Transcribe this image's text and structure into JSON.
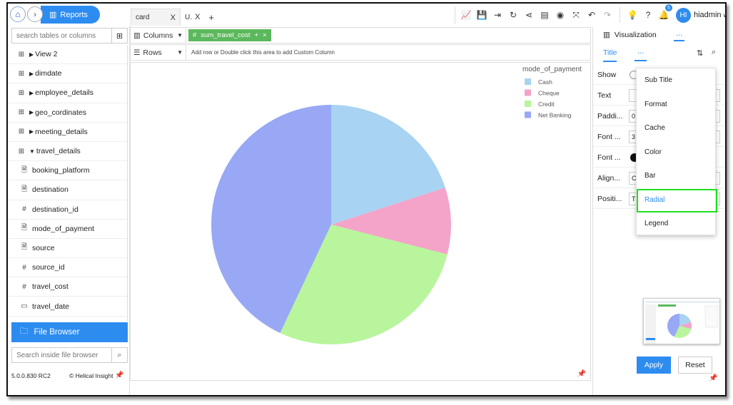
{
  "topbar": {
    "home_icon": "home-icon",
    "reports_label": "Reports",
    "tabs": [
      {
        "label": "card",
        "close": "X"
      },
      {
        "label": "U.",
        "close": "X"
      }
    ],
    "add_tab": "+",
    "notification_count": "5",
    "avatar_initials": "HI",
    "username": "hiadmin"
  },
  "left": {
    "search_placeholder": "search tables or columns",
    "tree": [
      {
        "label": "View 2",
        "icon": "table-icon",
        "level": 0
      },
      {
        "label": "dimdate",
        "icon": "table-icon",
        "level": 0
      },
      {
        "label": "employee_details",
        "icon": "table-icon",
        "level": 0
      },
      {
        "label": "geo_cordinates",
        "icon": "table-icon",
        "level": 0
      },
      {
        "label": "meeting_details",
        "icon": "table-icon",
        "level": 0
      },
      {
        "label": "travel_details",
        "icon": "table-icon",
        "level": 0
      },
      {
        "label": "booking_platform",
        "icon": "text-field-icon",
        "level": 1
      },
      {
        "label": "destination",
        "icon": "text-field-icon",
        "level": 1
      },
      {
        "label": "destination_id",
        "icon": "number-field-icon",
        "level": 1
      },
      {
        "label": "mode_of_payment",
        "icon": "text-field-icon",
        "level": 1
      },
      {
        "label": "source",
        "icon": "text-field-icon",
        "level": 1
      },
      {
        "label": "source_id",
        "icon": "number-field-icon",
        "level": 1
      },
      {
        "label": "travel_cost",
        "icon": "number-field-icon",
        "level": 1
      },
      {
        "label": "travel_date",
        "icon": "date-field-icon",
        "level": 1
      }
    ],
    "file_browser_label": "File Browser",
    "file_search_placeholder": "Search inside file browser",
    "version": "5.0.0.830 RC2",
    "brand": "Helical Insight"
  },
  "shelves": {
    "columns_label": "Columns",
    "column_pill": "sum_travel_cost",
    "rows_label": "Rows",
    "rows_hint": "Add row or Double click this area to add Custom Column"
  },
  "chart_data": {
    "type": "pie",
    "categories": [
      "Cash",
      "Cheque",
      "Credit",
      "Net Banking"
    ],
    "values": [
      20,
      9,
      28,
      43
    ],
    "colors": [
      "#a8d3f2",
      "#f3a4c8",
      "#b8f59c",
      "#98a8f4"
    ],
    "legend_title": "mode_of_payment",
    "legend_position": "top-right"
  },
  "right": {
    "visualization_label": "Visualization",
    "more_tab": "...",
    "title_tab": "Title",
    "rows": [
      {
        "label": "Show",
        "control": "toggle",
        "value": ""
      },
      {
        "label": "Text",
        "control": "input",
        "value": ""
      },
      {
        "label": "Paddi...",
        "control": "input",
        "value": "0"
      },
      {
        "label": "Font ...",
        "control": "input",
        "value": "3"
      },
      {
        "label": "Font ...",
        "control": "swatch",
        "value": ""
      },
      {
        "label": "Align...",
        "control": "input",
        "value": "C"
      },
      {
        "label": "Positi...",
        "control": "input",
        "value": "T"
      }
    ],
    "dropdown": [
      "Sub Title",
      "Format",
      "Cache",
      "Color",
      "Bar",
      "Radial",
      "Legend"
    ],
    "dropdown_selected": "Radial",
    "apply_label": "Apply",
    "reset_label": "Reset"
  }
}
